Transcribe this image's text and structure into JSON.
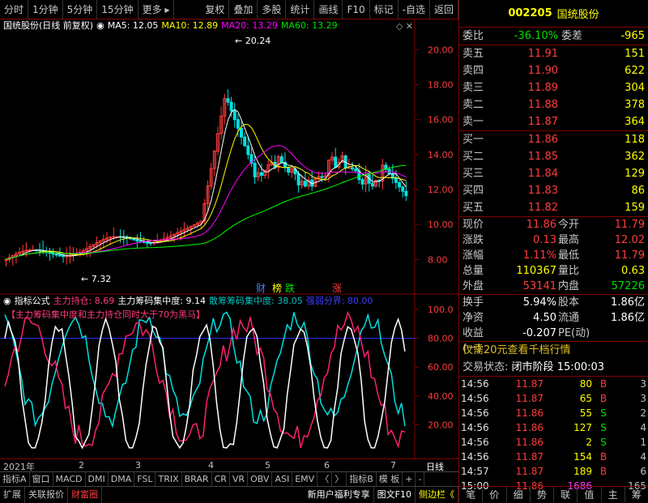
{
  "toolbar": {
    "left": [
      "分时",
      "1分钟",
      "5分钟",
      "15分钟",
      "更多"
    ],
    "right": [
      "复权",
      "叠加",
      "多股",
      "统计",
      "画线",
      "F10",
      "标记",
      "-自选",
      "返回"
    ]
  },
  "main_legend": {
    "name": "国统股份(日线 前复权)",
    "ma5": "MA5: 12.05",
    "ma10": "MA10: 12.89",
    "ma20": "MA20: 13.29",
    "ma60": "MA60: 13.29"
  },
  "price_axis": [
    "20.00",
    "18.00",
    "16.00",
    "14.00",
    "12.00",
    "10.00",
    "8.00"
  ],
  "annotations": {
    "high": "20.24",
    "low": "7.32"
  },
  "markers": {
    "cai": "财",
    "bang": "榜",
    "die": "跌",
    "zhang": "涨"
  },
  "ind_legend": {
    "name": "指标公式",
    "l1": "主力持仓: 8.69",
    "l2": "主力筹码集中度: 9.14",
    "l3": "散筹筹码集中度: 38.05",
    "l4": "强弱分界: 80.00",
    "note": "【主力筹码集中度和主力持仓同时大于70为黑马】"
  },
  "ind_axis": [
    "100.0",
    "80.00",
    "60.00",
    "40.00",
    "20.00"
  ],
  "date_axis": {
    "year": "2021年",
    "months": [
      "2",
      "3",
      "4",
      "5",
      "6",
      "7"
    ],
    "period": "日线"
  },
  "tabs": [
    "指标A",
    "窗口",
    "MACD",
    "DMI",
    "DMA",
    "FSL",
    "TRIX",
    "BRAR",
    "CR",
    "VR",
    "OBV",
    "ASI",
    "EMV",
    "〈",
    "〉",
    "指标B",
    "模 板",
    "+",
    "-"
  ],
  "bottom_bar": {
    "items": [
      "扩展",
      "关联报价",
      "财富圈"
    ],
    "right": [
      "新用户福利专享",
      "图文F10",
      "侧边栏《"
    ]
  },
  "quote": {
    "code": "002205",
    "name": "国统股份",
    "weibi_label": "委比",
    "weibi": "-36.10%",
    "weicha_label": "委差",
    "weicha": "-965",
    "asks": [
      {
        "label": "卖五",
        "price": "11.91",
        "vol": "151"
      },
      {
        "label": "卖四",
        "price": "11.90",
        "vol": "622"
      },
      {
        "label": "卖三",
        "price": "11.89",
        "vol": "304"
      },
      {
        "label": "卖二",
        "price": "11.88",
        "vol": "378"
      },
      {
        "label": "卖一",
        "price": "11.87",
        "vol": "364"
      }
    ],
    "bids": [
      {
        "label": "买一",
        "price": "11.86",
        "vol": "118"
      },
      {
        "label": "买二",
        "price": "11.85",
        "vol": "362"
      },
      {
        "label": "买三",
        "price": "11.84",
        "vol": "129"
      },
      {
        "label": "买四",
        "price": "11.83",
        "vol": "86"
      },
      {
        "label": "买五",
        "price": "11.82",
        "vol": "159"
      }
    ],
    "stats": [
      {
        "l1": "现价",
        "v1": "11.86",
        "c1": "red",
        "l2": "今开",
        "v2": "11.79",
        "c2": "red"
      },
      {
        "l1": "涨跌",
        "v1": "0.13",
        "c1": "red",
        "l2": "最高",
        "v2": "12.02",
        "c2": "red"
      },
      {
        "l1": "涨幅",
        "v1": "1.11%",
        "c1": "red",
        "l2": "最低",
        "v2": "11.79",
        "c2": "red"
      },
      {
        "l1": "总量",
        "v1": "110367",
        "c1": "yellow",
        "l2": "量比",
        "v2": "0.63",
        "c2": "yellow"
      },
      {
        "l1": "外盘",
        "v1": "53141",
        "c1": "red",
        "l2": "内盘",
        "v2": "57226",
        "c2": "green"
      }
    ],
    "stats2": [
      {
        "l1": "换手",
        "v1": "5.94%",
        "c1": "white",
        "l2": "股本",
        "v2": "1.86亿",
        "c2": "white"
      },
      {
        "l1": "净资",
        "v1": "4.50",
        "c1": "white",
        "l2": "流通",
        "v2": "1.86亿",
        "c2": "white"
      },
      {
        "l1": "收益(一)",
        "v1": "-0.207",
        "c1": "white",
        "l2": "PE(动)",
        "v2": "",
        "c2": "white"
      }
    ],
    "promo": "仅需20元查看千档行情",
    "status_label": "交易状态:",
    "status_val": "闭市阶段",
    "status_time": "15:00:03"
  },
  "ticks": [
    {
      "t": "14:56",
      "p": "11.87",
      "v": "80",
      "d": "B",
      "n": "3"
    },
    {
      "t": "14:56",
      "p": "11.87",
      "v": "65",
      "d": "B",
      "n": "3"
    },
    {
      "t": "14:56",
      "p": "11.86",
      "v": "55",
      "d": "S",
      "n": "2"
    },
    {
      "t": "14:56",
      "p": "11.86",
      "v": "127",
      "d": "S",
      "n": "4"
    },
    {
      "t": "14:56",
      "p": "11.86",
      "v": "2",
      "d": "S",
      "n": "1"
    },
    {
      "t": "14:56",
      "p": "11.87",
      "v": "154",
      "d": "B",
      "n": "4"
    },
    {
      "t": "14:57",
      "p": "11.87",
      "v": "189",
      "d": "B",
      "n": "6"
    },
    {
      "t": "15:00",
      "p": "11.86",
      "v": "1686",
      "d": "",
      "n": "165"
    }
  ],
  "right_tabs": [
    "笔",
    "价",
    "细",
    "势",
    "联",
    "值",
    "主",
    "筹"
  ],
  "colors": {
    "up": "#ff3c3c",
    "down": "#00e000",
    "ma5": "#ffffff",
    "ma10": "#ffff00",
    "ma20": "#ff00ff",
    "ma60": "#00ff00"
  }
}
